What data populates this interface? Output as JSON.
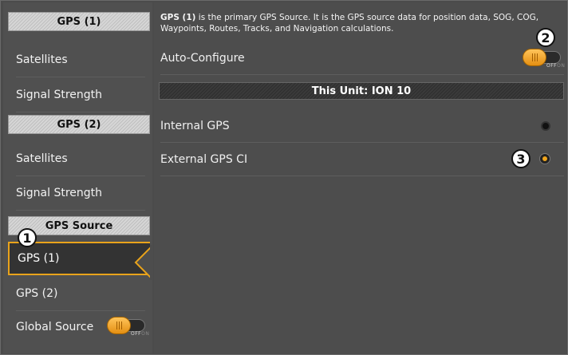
{
  "sidebar": {
    "gps1_header": "GPS (1)",
    "gps1_items": [
      "Satellites",
      "Signal Strength"
    ],
    "gps2_header": "GPS (2)",
    "gps2_items": [
      "Satellites",
      "Signal Strength"
    ],
    "source_header": "GPS Source",
    "source_items": [
      "GPS (1)",
      "GPS (2)"
    ],
    "global_source_label": "Global Source",
    "global_source_toggle": {
      "state": "on",
      "off_label": "OFF",
      "on_label": "ON"
    }
  },
  "main": {
    "description_bold": "GPS (1)",
    "description_rest": " is the primary GPS Source. It is the GPS source data for position data, SOG, COG, Waypoints, Routes, Tracks, and Navigation calculations.",
    "auto_configure_label": "Auto-Configure",
    "auto_configure_toggle": {
      "state": "on",
      "off_label": "OFF",
      "on_label": "ON"
    },
    "unit_header": "This Unit: ION 10",
    "options": [
      {
        "label": "Internal GPS",
        "selected": false
      },
      {
        "label": "External GPS CI",
        "selected": true
      }
    ]
  },
  "callouts": [
    "1",
    "2",
    "3"
  ],
  "colors": {
    "accent": "#f0a51d",
    "panel": "#4d4d4d",
    "header_light": "#d0d0d0"
  }
}
